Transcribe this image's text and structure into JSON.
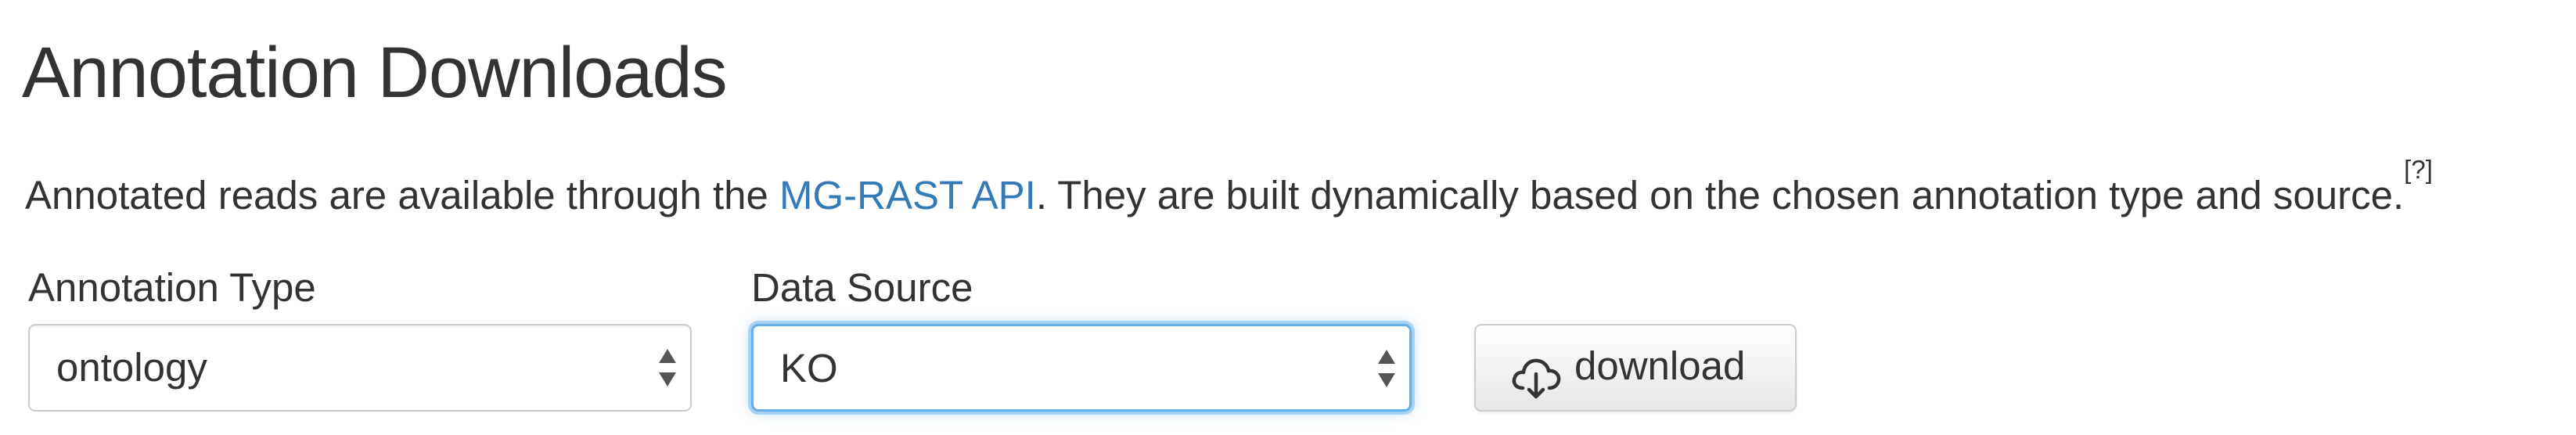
{
  "page": {
    "title": "Annotation Downloads"
  },
  "description": {
    "before_link": "Annotated reads are available through the ",
    "link_text": "MG-RAST API",
    "after_link": ". They are built dynamically based on the chosen annotation type and source.",
    "help_text": "[?]"
  },
  "annotation_type": {
    "label": "Annotation Type",
    "selected": "ontology"
  },
  "data_source": {
    "label": "Data Source",
    "selected": "KO"
  },
  "download_button": {
    "label": "download",
    "icon": "cloud-download-icon"
  },
  "colors": {
    "link": "#337ab7",
    "text": "#333333",
    "focus": "#66afe9"
  }
}
